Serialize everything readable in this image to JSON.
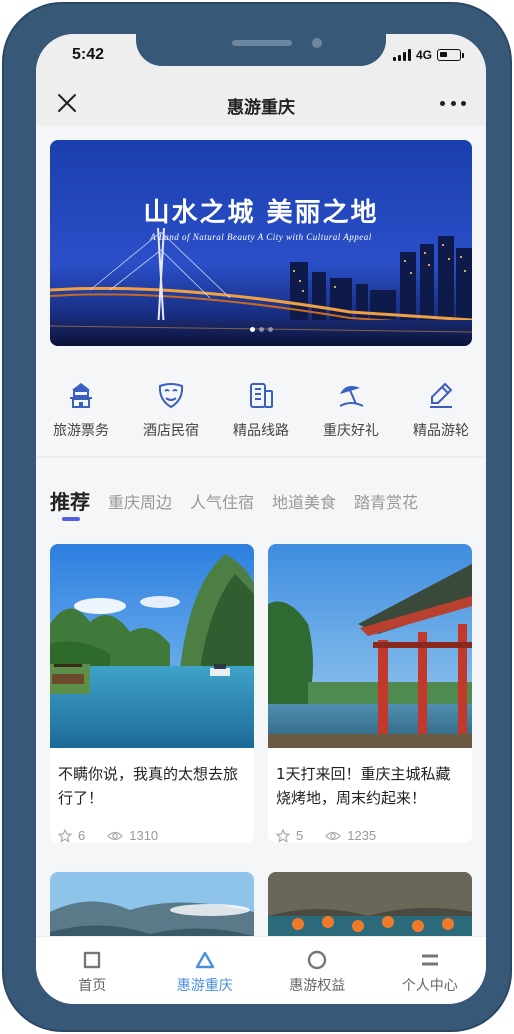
{
  "status_bar": {
    "time": "5:42",
    "network": "4G"
  },
  "nav": {
    "title": "惠游重庆"
  },
  "banner": {
    "title": "山水之城  美丽之地",
    "subtitle": "A Land of Natural Beauty   A City with Cultural Appeal",
    "active_slide": 1,
    "slide_count": 3
  },
  "categories": [
    {
      "label": "旅游票务",
      "icon": "pagoda-icon"
    },
    {
      "label": "酒店民宿",
      "icon": "mask-icon"
    },
    {
      "label": "精品线路",
      "icon": "building-icon"
    },
    {
      "label": "重庆好礼",
      "icon": "beach-umbrella-icon"
    },
    {
      "label": "精品游轮",
      "icon": "pen-icon"
    }
  ],
  "tabs": [
    "推荐",
    "重庆周边",
    "人气住宿",
    "地道美食",
    "踏青赏花"
  ],
  "cards": [
    {
      "title": "不瞒你说，我真的太想去旅行了！",
      "likes": "6",
      "views": "1310"
    },
    {
      "title": "1天打来回！重庆主城私藏烧烤地，周末约起来！",
      "likes": "5",
      "views": "1235"
    }
  ],
  "tabbar": [
    {
      "label": "首页",
      "icon": "square-icon",
      "active": false
    },
    {
      "label": "惠游重庆",
      "icon": "triangle-icon",
      "active": true
    },
    {
      "label": "惠游权益",
      "icon": "circle-icon",
      "active": false
    },
    {
      "label": "个人中心",
      "icon": "lines-icon",
      "active": false
    }
  ],
  "colors": {
    "accent": "#4a90e2",
    "tab_indicator": "#5060e8",
    "frame": "#385878"
  }
}
